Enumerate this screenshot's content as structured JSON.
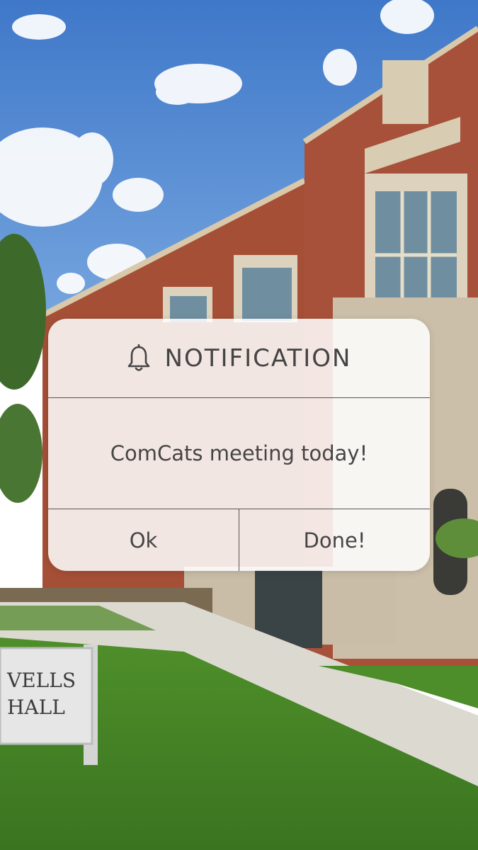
{
  "notification": {
    "title": "NOTIFICATION",
    "icon": "bell-icon",
    "message": "ComCats meeting today!",
    "buttons": {
      "ok": "Ok",
      "done": "Done!"
    }
  },
  "background": {
    "sign_text": [
      "VELLS",
      "HALL"
    ]
  }
}
